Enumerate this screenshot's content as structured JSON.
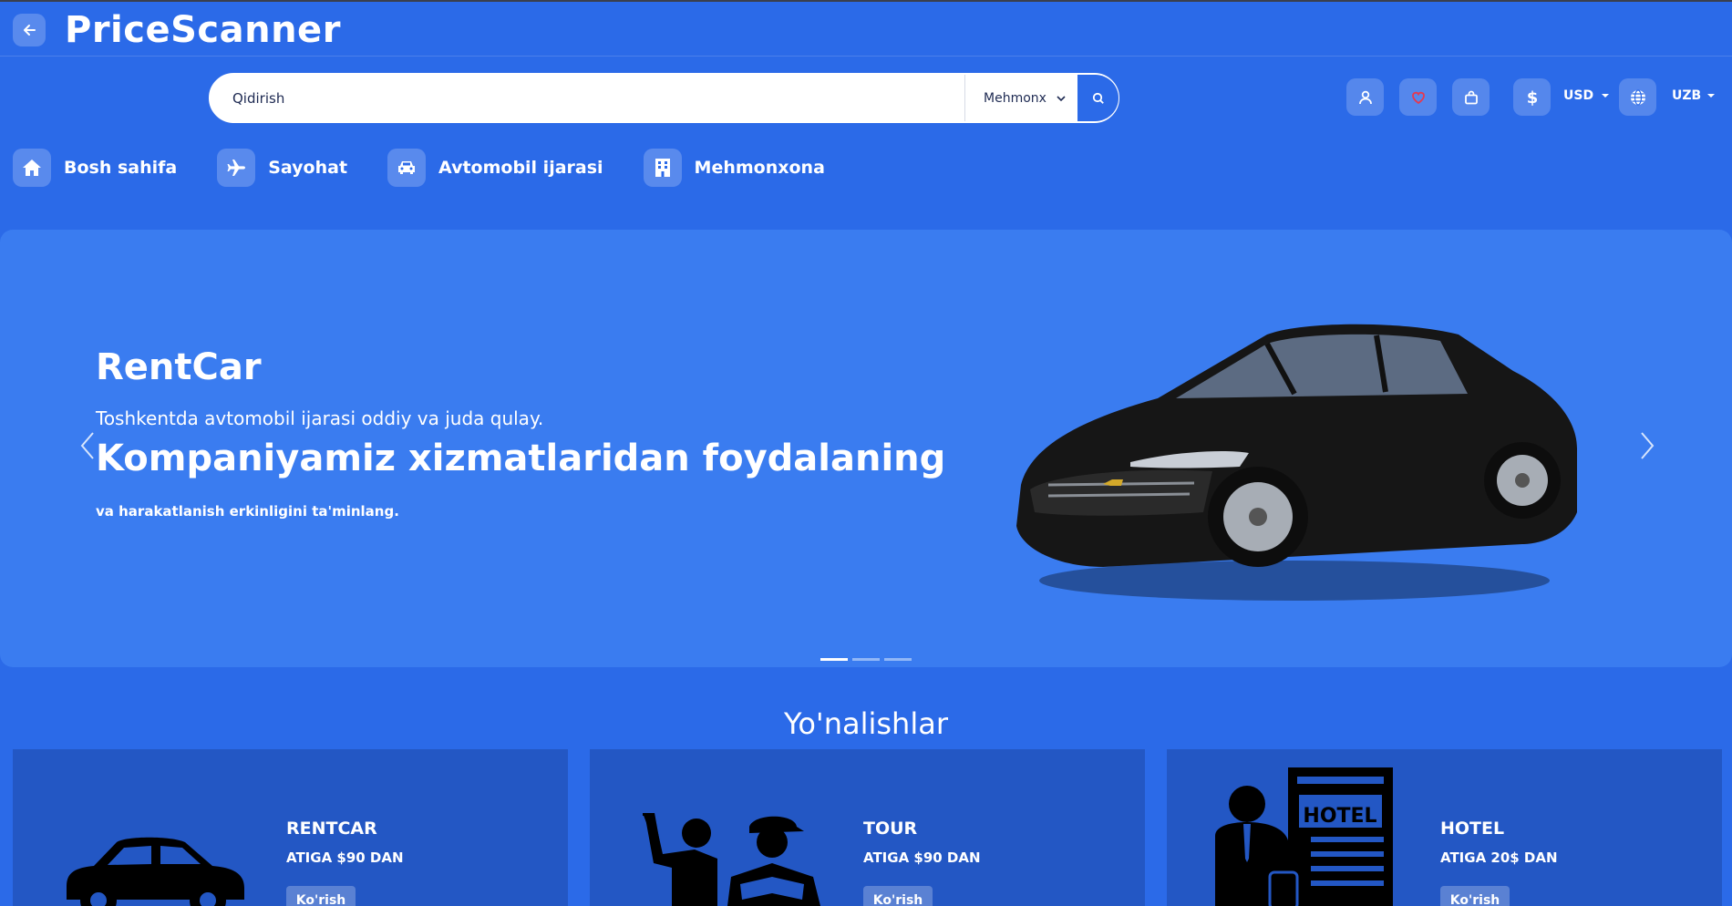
{
  "header": {
    "brand": "PriceScanner",
    "search_placeholder": "Qidirish",
    "search_category": "Mehmonx",
    "currency": "USD",
    "language": "UZB"
  },
  "nav": {
    "items": [
      {
        "label": "Bosh sahifa",
        "icon": "home-icon"
      },
      {
        "label": "Sayohat",
        "icon": "plane-icon"
      },
      {
        "label": "Avtomobil ijarasi",
        "icon": "car-icon"
      },
      {
        "label": "Mehmonxona",
        "icon": "building-icon"
      }
    ]
  },
  "hero": {
    "title": "RentCar",
    "subtitle": "Toshkentda avtomobil ijarasi oddiy va juda qulay.",
    "headline": "Kompaniyamiz xizmatlaridan foydalaning",
    "small": "va harakatlanish erkinligini ta'minlang.",
    "slide_count": 3,
    "active_slide": 1
  },
  "destinations": {
    "title": "Yo'nalishlar",
    "cards": [
      {
        "name": "RENTCAR",
        "price": "ATIGA $90 DAN",
        "button": "Ko'rish",
        "icon": "car-icon"
      },
      {
        "name": "TOUR",
        "price": "ATIGA $90 DAN",
        "button": "Ko'rish",
        "icon": "tourists-icon"
      },
      {
        "name": "HOTEL",
        "price": "ATIGA 20$ DAN",
        "button": "Ko'rish",
        "icon": "hotel-icon",
        "sign": "HOTEL"
      }
    ]
  },
  "colors": {
    "background": "#2b6ae8",
    "hero": "#3a7cf0",
    "card": "#2357c4",
    "heart": "#e53950"
  }
}
